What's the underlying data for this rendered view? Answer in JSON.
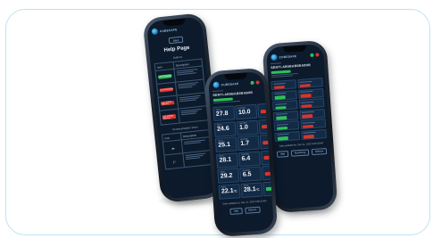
{
  "colors": {
    "screen_bg": "#0c1a2b",
    "card_border": "#bfe3ef",
    "ok_green": "#2fbf5a",
    "alert_red": "#d8342c",
    "text_light": "#e6eef7"
  },
  "logo": {
    "text": "CUBESAFE",
    "icon": "logo-icon"
  },
  "help_screen": {
    "back_label": "Back",
    "title": "Help Page",
    "buttons_section": "Buttons",
    "table_headers": [
      "Icon",
      "Description"
    ],
    "rows": [
      {
        "pill_color": "#2fbf5a",
        "pill_label": "Low Probability"
      },
      {
        "pill_color": "#d8342c",
        "pill_label": "Low Probability"
      },
      {
        "pill_color": "#d8342c",
        "pill_label": "Low Voltage Warning"
      },
      {
        "pill_color": "#d8342c",
        "pill_label": "Low Voltage Warning"
      }
    ],
    "communication_section": "Communication Icons",
    "icon_rows": [
      {
        "icon": "cloud-icon"
      },
      {
        "icon": "bluetooth-icon"
      }
    ]
  },
  "readings_screen": {
    "device_label": "Sensor",
    "device_name": "SENTI-AB0BAB0BAB0B",
    "readings": [
      {
        "label": "Temp",
        "value": "27.8",
        "unit": "",
        "flag": "#2fbf5a"
      },
      {
        "label": "Humidity",
        "value": "10.0",
        "unit": "",
        "flag": "#d8342c"
      },
      {
        "label": "Temp",
        "value": "24.6",
        "unit": "",
        "flag": "#2fbf5a"
      },
      {
        "label": "Humidity",
        "value": "1.0",
        "unit": "",
        "flag": "#d8342c"
      },
      {
        "label": "Temp",
        "value": "25.1",
        "unit": "",
        "flag": "#2fbf5a"
      },
      {
        "label": "Humidity",
        "value": "1.7",
        "unit": "",
        "flag": "#d8342c"
      },
      {
        "label": "Temp",
        "value": "28.1",
        "unit": "",
        "flag": "#2fbf5a"
      },
      {
        "label": "Humidity",
        "value": "6.4",
        "unit": "",
        "flag": "#d8342c"
      },
      {
        "label": "Temp",
        "value": "29.2",
        "unit": "",
        "flag": "#2fbf5a"
      },
      {
        "label": "Humidity",
        "value": "6.5",
        "unit": "",
        "flag": "#d8342c"
      },
      {
        "label": "Temp",
        "value": "22.1",
        "unit": "°C",
        "flag": "#2fbf5a"
      },
      {
        "label": "Temp",
        "value": "28.1",
        "unit": "°C",
        "flag": "#2fbf5a"
      }
    ],
    "updated": "Data updated on: Dec 11, 2022 9:50:32AM",
    "buttons": [
      "Help",
      "Refresh"
    ]
  },
  "status_screen": {
    "device_label": "Sensor",
    "device_name": "SENTI-AB0BAB0BAB0B",
    "updated": "Data updated on: Dec 11, 2022 9:50:32AM",
    "buttons": [
      "Help",
      "Monitoring",
      "Refresh"
    ]
  }
}
